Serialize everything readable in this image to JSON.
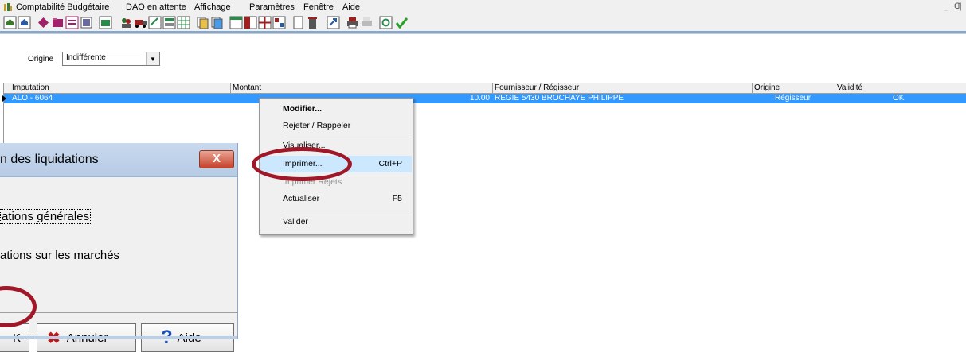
{
  "menubar": {
    "items": [
      "Comptabilité Budgétaire",
      "DAO en attente",
      "Affichage",
      "Paramètres",
      "Fenêtre",
      "Aide"
    ],
    "window_controls": [
      "_",
      "Ƣ"
    ]
  },
  "toolbar": {
    "button_count": 32,
    "colors": {
      "bg": "#f0f0f0",
      "accent": "#7ea8d8"
    }
  },
  "filter": {
    "label": "Origine",
    "value": "Indifférente"
  },
  "grid": {
    "columns": [
      "Imputation",
      "Montant",
      "Fournisseur / Régisseur",
      "Origine",
      "Validité"
    ],
    "rows": [
      {
        "imputation": "ALO - 6064",
        "montant": "10.00",
        "fournisseur": "REGIE 5430 BROCHAYE PHILIPPE",
        "origine": "Régisseur",
        "validite": "OK",
        "selected": true
      }
    ],
    "selection_color": "#3399ff"
  },
  "context_menu": {
    "items": [
      {
        "label": "Modifier...",
        "shortcut": "",
        "bold": true,
        "disabled": false
      },
      {
        "label": "Rejeter / Rappeler",
        "shortcut": "",
        "bold": false,
        "disabled": false
      },
      {
        "label": "Visualiser...",
        "shortcut": "",
        "bold": false,
        "disabled": false
      },
      {
        "label": "Imprimer...",
        "shortcut": "Ctrl+P",
        "bold": false,
        "disabled": false,
        "highlighted": true
      },
      {
        "label": "Imprimer Rejets",
        "shortcut": "",
        "bold": false,
        "disabled": true
      },
      {
        "label": "Actualiser",
        "shortcut": "F5",
        "bold": false,
        "disabled": false
      },
      {
        "label": "Valider",
        "shortcut": "",
        "bold": false,
        "disabled": false
      }
    ]
  },
  "dialog": {
    "title": "n des liquidations",
    "close_label": "X",
    "options": [
      "ations générales",
      "ations sur les marchés"
    ],
    "buttons": {
      "ok_label": "K",
      "cancel_label": "Annuler",
      "help_label": "Aide"
    }
  },
  "annotation_color": "#a01828"
}
